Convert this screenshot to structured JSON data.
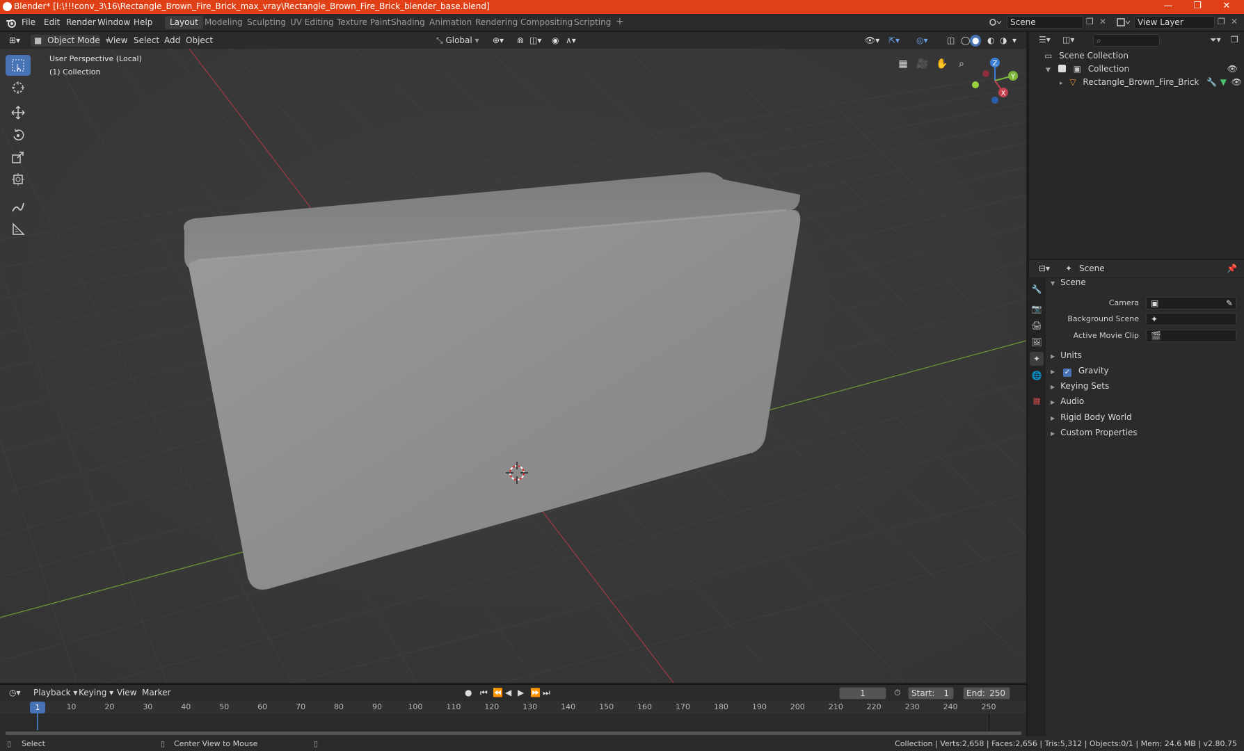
{
  "window": {
    "title": "Blender* [I:\\!!!conv_3\\16\\Rectangle_Brown_Fire_Brick_max_vray\\Rectangle_Brown_Fire_Brick_blender_base.blend]",
    "minimize_glyph": "—",
    "restore_glyph": "❐",
    "close_glyph": "✕"
  },
  "menu": {
    "file": "File",
    "edit": "Edit",
    "render": "Render",
    "window": "Window",
    "help": "Help"
  },
  "workspaces": [
    "Layout",
    "Modeling",
    "Sculpting",
    "UV Editing",
    "Texture Paint",
    "Shading",
    "Animation",
    "Rendering",
    "Compositing",
    "Scripting"
  ],
  "workspace_add": "+",
  "scene_selector": {
    "value": "Scene"
  },
  "view_layer_selector": {
    "value": "View Layer"
  },
  "viewport_header": {
    "mode": "Object Mode",
    "view": "View",
    "select": "Select",
    "add": "Add",
    "object": "Object",
    "orientation": "Global"
  },
  "viewport": {
    "perspective_label": "User Perspective (Local)",
    "collection_label": "(1) Collection",
    "axis_x": "X",
    "axis_y": "Y",
    "axis_z": "Z"
  },
  "outliner": {
    "search_placeholder": "",
    "scene_collection": "Scene Collection",
    "collection": "Collection",
    "object": "Rectangle_Brown_Fire_Brick"
  },
  "properties": {
    "header_title": "Scene",
    "panel_title": "Scene",
    "camera_label": "Camera",
    "background_scene_label": "Background Scene",
    "active_movie_clip_label": "Active Movie Clip",
    "sections": {
      "units": "Units",
      "gravity": "Gravity",
      "keying_sets": "Keying Sets",
      "audio": "Audio",
      "rigid_body_world": "Rigid Body World",
      "custom_properties": "Custom Properties"
    },
    "gravity_checked": true
  },
  "timeline": {
    "playback": "Playback",
    "keying": "Keying",
    "view": "View",
    "marker": "Marker",
    "current_frame": "1",
    "start_label": "Start:",
    "start_value": "1",
    "end_label": "End:",
    "end_value": "250",
    "ruler_ticks": [
      "10",
      "20",
      "30",
      "40",
      "50",
      "60",
      "70",
      "80",
      "90",
      "100",
      "110",
      "120",
      "130",
      "140",
      "150",
      "160",
      "170",
      "180",
      "190",
      "200",
      "210",
      "220",
      "230",
      "240",
      "250"
    ],
    "playhead_label": "1"
  },
  "statusbar": {
    "select": "Select",
    "center_view": "Center View to Mouse",
    "stats": "Collection | Verts:2,658 | Faces:2,656 | Tris:5,312 | Objects:0/1 | Mem: 24.6 MB | v2.80.75"
  },
  "colors": {
    "title_bar": "#df4016",
    "active_tool": "#4772b3",
    "viewport_bg": "#393939",
    "x_axis": "#c3414f",
    "y_axis": "#7db43b",
    "z_axis": "#3a7fd6"
  }
}
